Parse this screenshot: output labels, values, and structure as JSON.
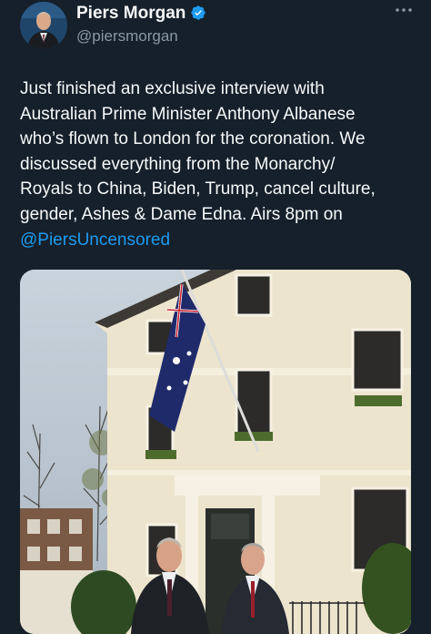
{
  "author": {
    "display_name": "Piers Morgan",
    "handle": "@piersmorgan",
    "verified": true,
    "verified_icon": "verified-badge-icon"
  },
  "tweet": {
    "lines": [
      "Just finished an exclusive interview with",
      "Australian Prime Minister Anthony Albanese",
      "who’s flown to London for the coronation. We",
      "discussed everything from the Monarchy/",
      "Royals to China, Biden, Trump, cancel culture,",
      "gender, Ashes & Dame Edna. Airs 8pm on"
    ],
    "mention": "@PiersUncensored"
  },
  "media": {
    "description_icon": "photo-image",
    "building_color": "#ece4cd",
    "flag": "Australian flag"
  },
  "colors": {
    "background": "#15202b",
    "text": "#f7f9f9",
    "secondary": "#8b98a5",
    "link": "#1d9bf0",
    "verified": "#1d9bf0"
  }
}
